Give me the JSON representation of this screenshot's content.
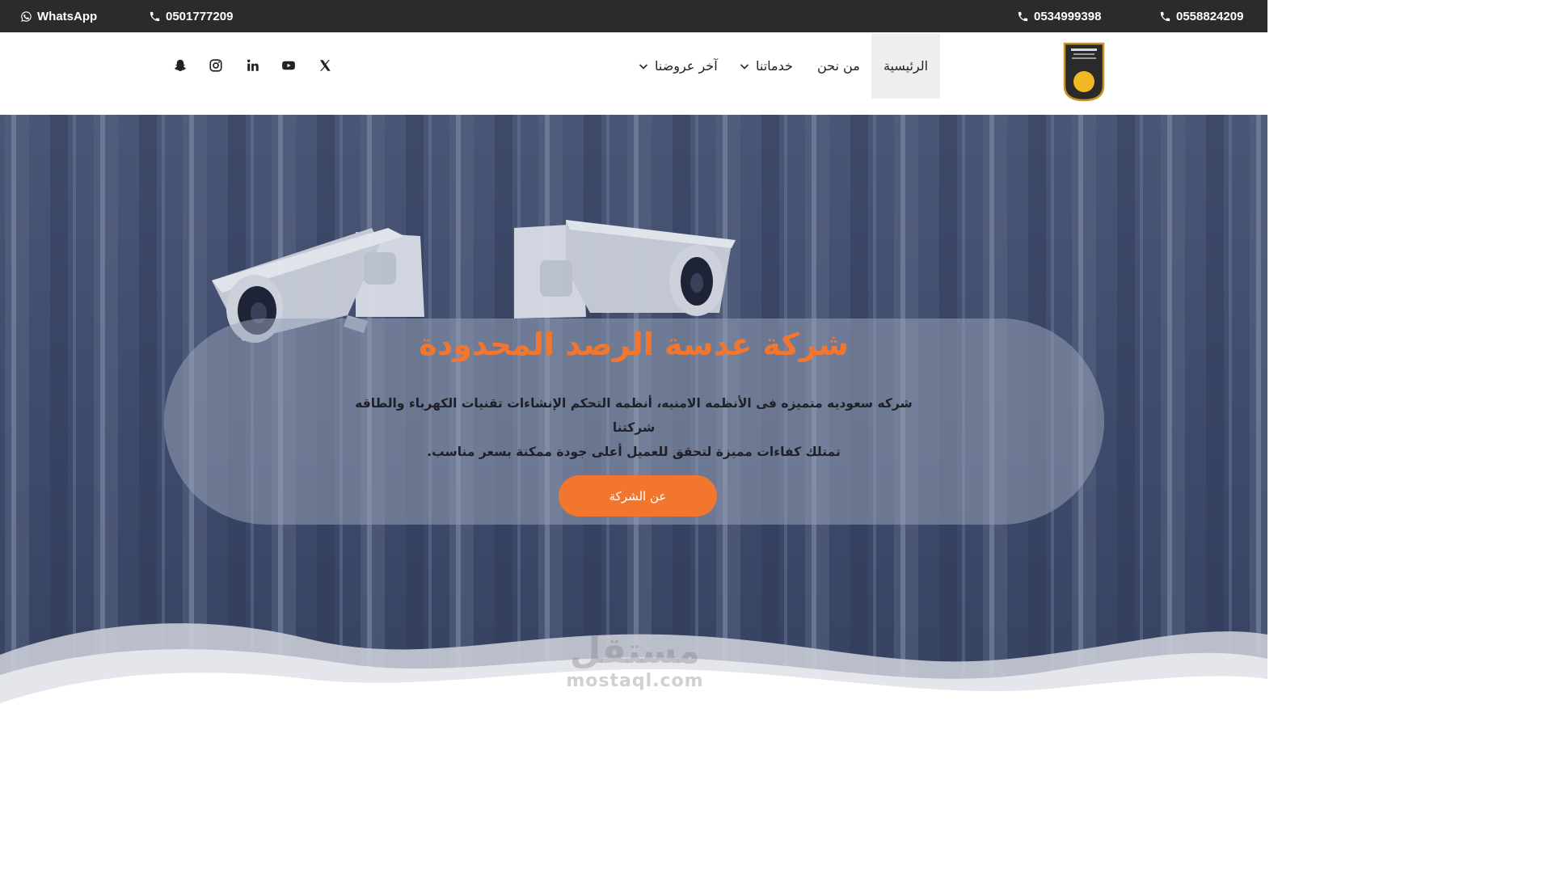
{
  "topbar": {
    "whatsapp_label": "WhatsApp",
    "phone_1": "0501777209",
    "phone_2": "0534999398",
    "phone_3": "0558824209",
    "background": "#2b2b2b"
  },
  "header": {
    "nav": {
      "home": "الرئيسية",
      "about": "من نحن",
      "services": "خدماتنا",
      "offers": "آخر عروضنا"
    },
    "social_icons": [
      "x-icon",
      "youtube-icon",
      "linkedin-icon",
      "instagram-icon",
      "snapchat-icon"
    ]
  },
  "hero": {
    "title": "شركة عدسة الرصد المحدودة",
    "text_line_1": "شركه سعوديه متميزه فى الأنظمه الامنيه، أنظمه التحكم الإنشاءات تقنيات الكهرباء والطاقه شركتنا",
    "text_line_2": "تمتلك كفاءات مميزة لتحقق للعميل أعلى جودة ممكنة بسعر مناسب.",
    "button_label": "عن الشركة",
    "accent_color": "#f2762e"
  },
  "watermark": {
    "arabic": "مستقل",
    "latin": "mostaql.com"
  }
}
